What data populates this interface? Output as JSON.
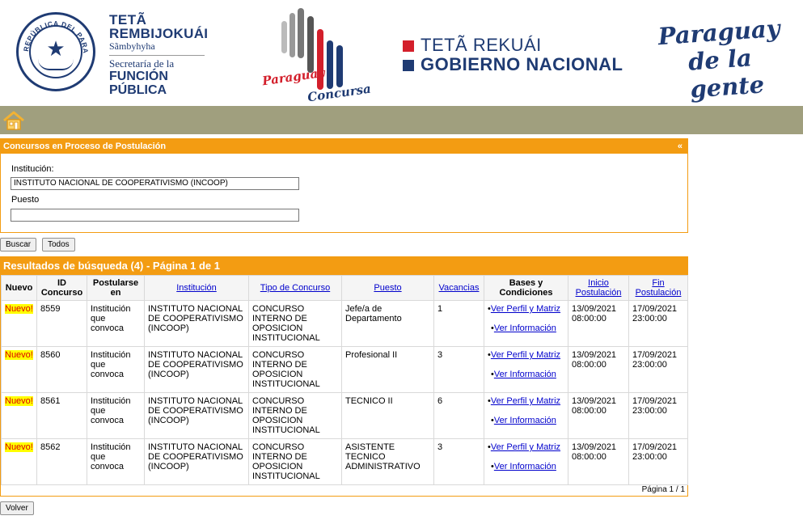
{
  "header": {
    "seal_text": "REPÚBLICA DEL PARAGUAY",
    "fp": {
      "line1": "TETÃ",
      "line2": "REMBIJOKUÁI",
      "line3": "Sãmbyhyha",
      "line4": "Secretaría de la",
      "line5": "FUNCIÓN",
      "line6": "PÚBLICA"
    },
    "concursa": {
      "text1": "Paraguay",
      "text2": "Concursa"
    },
    "gobierno": {
      "line1": "TETÃ REKUÁI",
      "line2": "GOBIERNO NACIONAL"
    },
    "slogan": {
      "line1": "Paraguay",
      "line2": "de la gente"
    }
  },
  "colors": {
    "accent": "#f39c12",
    "navbar": "#a09f7e",
    "brand_blue": "#1f3b73",
    "brand_red": "#d31f2b",
    "badge": "#ffff00"
  },
  "icons": {
    "home": "home-icon"
  },
  "search_panel": {
    "title": "Concursos en Proceso de Postulación",
    "collapse": "«",
    "institucion_label": "Institución:",
    "institucion_value": "INSTITUTO NACIONAL DE COOPERATIVISMO (INCOOP)",
    "puesto_label": "Puesto",
    "puesto_value": ""
  },
  "buttons": {
    "buscar": "Buscar",
    "todos": "Todos",
    "volver": "Volver"
  },
  "results": {
    "title": "Resultados de búsqueda (4) - Página 1 de 1",
    "headers": {
      "nuevo": "Nuevo",
      "id": "ID Concurso",
      "postularse": "Postularse en",
      "institucion": "Institución",
      "tipo": "Tipo de Concurso",
      "puesto": "Puesto",
      "vacancias": "Vacancias",
      "bases": "Bases y Condiciones",
      "inicio": "Inicio Postulación",
      "fin": "Fin Postulación"
    },
    "rows": [
      {
        "nuevo": "Nuevo!",
        "id": "8559",
        "postularse": "Institución que convoca",
        "institucion": "INSTITUTO NACIONAL DE COOPERATIVISMO (INCOOP)",
        "tipo": "CONCURSO INTERNO DE OPOSICION INSTITUCIONAL",
        "puesto": "Jefe/a de Departamento",
        "vacancias": "1",
        "link1": "Ver Perfil y Matriz",
        "link2": "Ver Información",
        "inicio": "13/09/2021 08:00:00",
        "fin": "17/09/2021 23:00:00"
      },
      {
        "nuevo": "Nuevo!",
        "id": "8560",
        "postularse": "Institución que convoca",
        "institucion": "INSTITUTO NACIONAL DE COOPERATIVISMO (INCOOP)",
        "tipo": "CONCURSO INTERNO DE OPOSICION INSTITUCIONAL",
        "puesto": "Profesional II",
        "vacancias": "3",
        "link1": "Ver Perfil y Matriz",
        "link2": "Ver Información",
        "inicio": "13/09/2021 08:00:00",
        "fin": "17/09/2021 23:00:00"
      },
      {
        "nuevo": "Nuevo!",
        "id": "8561",
        "postularse": "Institución que convoca",
        "institucion": "INSTITUTO NACIONAL DE COOPERATIVISMO (INCOOP)",
        "tipo": "CONCURSO INTERNO DE OPOSICION INSTITUCIONAL",
        "puesto": "TECNICO II",
        "vacancias": "6",
        "link1": "Ver Perfil y Matriz",
        "link2": "Ver Información",
        "inicio": "13/09/2021 08:00:00",
        "fin": "17/09/2021 23:00:00"
      },
      {
        "nuevo": "Nuevo!",
        "id": "8562",
        "postularse": "Institución que convoca",
        "institucion": "INSTITUTO NACIONAL DE COOPERATIVISMO (INCOOP)",
        "tipo": "CONCURSO INTERNO DE OPOSICION INSTITUCIONAL",
        "puesto": "ASISTENTE TECNICO ADMINISTRATIVO",
        "vacancias": "3",
        "link1": "Ver Perfil y Matriz",
        "link2": "Ver Información",
        "inicio": "13/09/2021 08:00:00",
        "fin": "17/09/2021 23:00:00"
      }
    ],
    "pager": "Página 1 / 1"
  }
}
